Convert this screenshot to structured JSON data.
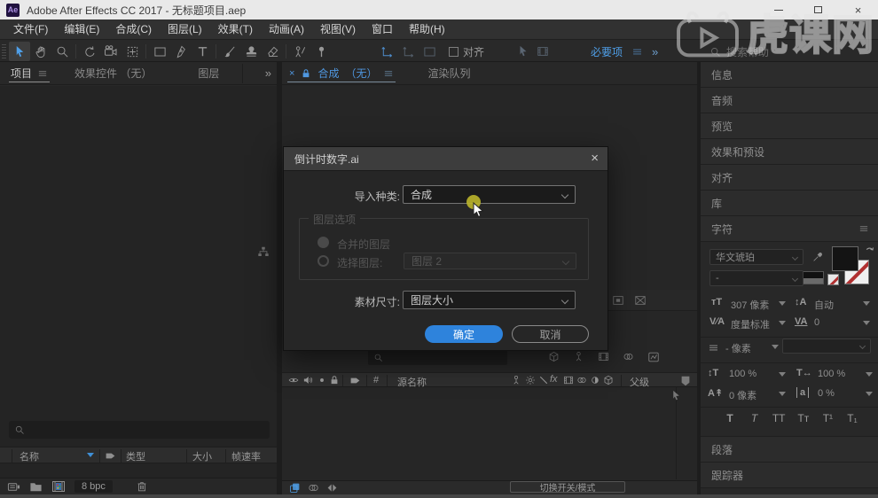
{
  "window": {
    "logo": "Ae",
    "title": "Adobe After Effects CC 2017 - 无标题项目.aep"
  },
  "menubar": {
    "items": [
      "文件(F)",
      "编辑(E)",
      "合成(C)",
      "图层(L)",
      "效果(T)",
      "动画(A)",
      "视图(V)",
      "窗口",
      "帮助(H)"
    ]
  },
  "toolbar": {
    "align_label": "对齐",
    "workspace_label": "必要项",
    "search_help": "搜索帮助"
  },
  "watermark": {
    "text": "虎课网"
  },
  "project": {
    "tab_project": "项目",
    "tab_effect_controls": "效果控件 （无）",
    "tab_layer": "图层",
    "overflow": "»",
    "col_name": "名称",
    "col_type": "类型",
    "col_size": "大小",
    "col_framerate": "帧速率",
    "bpc": "8 bpc"
  },
  "viewer": {
    "tab_composition": "合成",
    "tab_composition_suffix": "（无）",
    "tab_render_queue": "渲染队列"
  },
  "dialog": {
    "title": "倒计时数字.ai",
    "close": "×",
    "import_kind_label": "导入种类:",
    "import_kind_value": "合成",
    "layer_options_label": "图层选项",
    "merged_layers_label": "合并的图层",
    "choose_layer_label": "选择图层:",
    "choose_layer_value": "图层 2",
    "footage_label": "素材尺寸:",
    "footage_value": "图层大小",
    "ok_label": "确定",
    "cancel_label": "取消"
  },
  "timeline": {
    "hash": "#",
    "source_name": "源名称",
    "parent": "父级",
    "toggle_label": "切换开关/模式"
  },
  "right_panel": {
    "tabs": [
      "信息",
      "音频",
      "预览",
      "效果和预设",
      "对齐",
      "库",
      "字符"
    ],
    "paragraph_tab": "段落",
    "tracker_tab": "跟踪器"
  },
  "character": {
    "font": "华文琥珀",
    "style": "-",
    "size": "307 像素",
    "leading": "自动",
    "kerning": "度量标准",
    "tracking": "0",
    "stroke_width": "- 像素",
    "vertical_scale": "100 %",
    "horizontal_scale": "100 %",
    "baseline_shift": "0 像素",
    "tsume": "0 %",
    "style_buttons": [
      "T",
      "T",
      "TT",
      "Tт",
      "T¹",
      "T₁"
    ]
  },
  "colors": {
    "accent_blue": "#2e83dc",
    "link_blue": "#4f9fe8",
    "titlebar_bg": "#e9e9e9",
    "panel_bg": "#282828"
  }
}
